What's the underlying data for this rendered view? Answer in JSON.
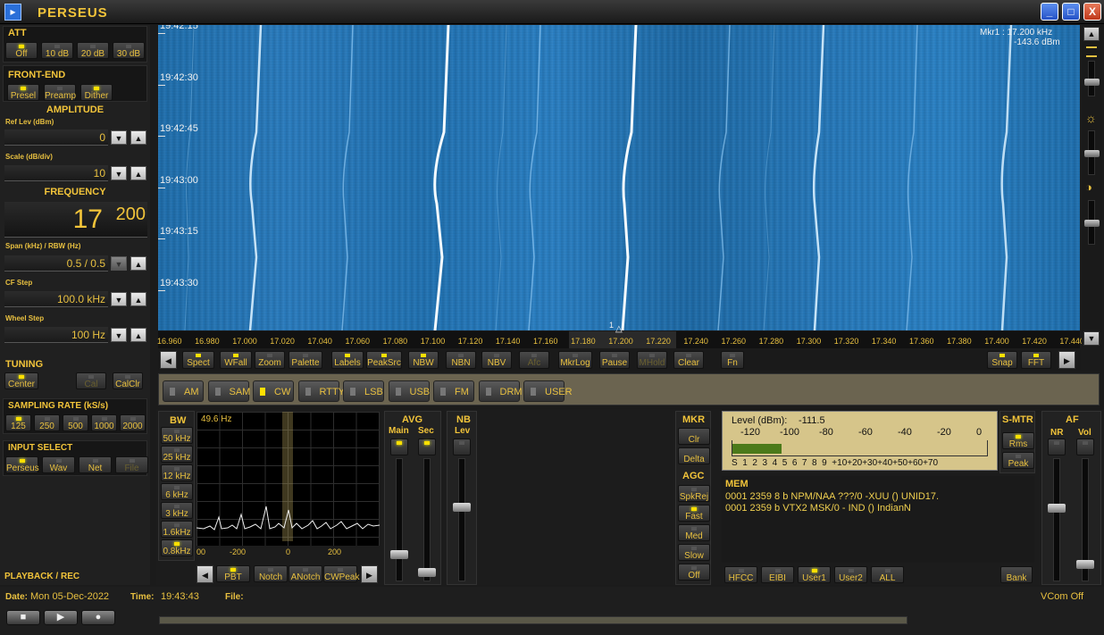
{
  "app": {
    "title": "PERSEUS",
    "logo_icon": "perseus-logo-icon"
  },
  "window_controls": {
    "minimize": "_",
    "maximize": "□",
    "close": "X"
  },
  "att": {
    "title": "ATT",
    "buttons": [
      {
        "label": "Off",
        "on": true
      },
      {
        "label": "10 dB",
        "on": false
      },
      {
        "label": "20 dB",
        "on": false
      },
      {
        "label": "30 dB",
        "on": false
      }
    ]
  },
  "frontend": {
    "title": "FRONT-END",
    "buttons": [
      {
        "label": "Presel",
        "on": true
      },
      {
        "label": "Preamp",
        "on": false
      },
      {
        "label": "Dither",
        "on": true
      }
    ]
  },
  "amplitude": {
    "title": "AMPLITUDE",
    "ref_lev_label": "Ref Lev (dBm)",
    "ref_lev_value": "0",
    "scale_label": "Scale (dB/div)",
    "scale_value": "10"
  },
  "frequency": {
    "title": "FREQUENCY",
    "main": "17",
    "sub": "200",
    "span_label": "Span (kHz) / RBW (Hz)",
    "span_value": "0.5 / 0.5",
    "cf_step_label": "CF Step",
    "cf_step_value": "100.0 kHz",
    "wheel_step_label": "Wheel Step",
    "wheel_step_value": "100 Hz"
  },
  "tuning": {
    "title": "TUNING",
    "buttons": [
      {
        "label": "Center",
        "on": true,
        "dis": false
      },
      {
        "label": "Cal",
        "on": false,
        "dis": true
      },
      {
        "label": "CalClr",
        "on": false,
        "dis": false
      }
    ]
  },
  "sampling": {
    "title": "SAMPLING RATE (kS/s)",
    "buttons": [
      {
        "label": "125",
        "on": true
      },
      {
        "label": "250",
        "on": false
      },
      {
        "label": "500",
        "on": false
      },
      {
        "label": "1000",
        "on": false
      },
      {
        "label": "2000",
        "on": false
      }
    ]
  },
  "input": {
    "title": "INPUT SELECT",
    "buttons": [
      {
        "label": "Perseus",
        "on": true,
        "dis": false
      },
      {
        "label": "Wav",
        "on": false,
        "dis": false
      },
      {
        "label": "Net",
        "on": false,
        "dis": false
      },
      {
        "label": "File",
        "on": false,
        "dis": true
      }
    ]
  },
  "playback": {
    "title": "PLAYBACK / REC"
  },
  "waterfall": {
    "times": [
      "19:42:15",
      "19:42:30",
      "19:42:45",
      "19:43:00",
      "19:43:15",
      "19:43:30"
    ],
    "marker_lines": [
      "Mkr1 : 17.200  kHz",
      "-143.6   dBm"
    ],
    "marker_num": "1",
    "axis_ticks": [
      "16.960",
      "16.980",
      "17.000",
      "17.020",
      "17.040",
      "17.060",
      "17.080",
      "17.100",
      "17.120",
      "17.140",
      "17.160",
      "17.180",
      "17.200",
      "17.220",
      "17.240",
      "17.260",
      "17.280",
      "17.300",
      "17.320",
      "17.340",
      "17.360",
      "17.380",
      "17.400",
      "17.420",
      "17.440"
    ]
  },
  "toolbar": {
    "buttons": [
      {
        "label": "Spect",
        "on": true,
        "dis": false
      },
      {
        "label": "WFall",
        "on": true,
        "dis": false
      },
      {
        "label": "Zoom",
        "on": false,
        "dis": false
      },
      {
        "label": "Palette",
        "on": false,
        "dis": false
      },
      {
        "label": "Labels",
        "on": true,
        "dis": false
      },
      {
        "label": "PeakSrc",
        "on": true,
        "dis": false
      },
      {
        "label": "NBW",
        "on": true,
        "dis": false
      },
      {
        "label": "NBN",
        "on": false,
        "dis": false
      },
      {
        "label": "NBV",
        "on": false,
        "dis": false
      },
      {
        "label": "Afc",
        "on": false,
        "dis": true
      },
      {
        "label": "MkrLog",
        "on": false,
        "dis": false
      },
      {
        "label": "Pause",
        "on": false,
        "dis": false
      },
      {
        "label": "MHold",
        "on": false,
        "dis": true
      },
      {
        "label": "Clear",
        "on": false,
        "dis": false
      },
      {
        "label": "Fn",
        "on": false,
        "dis": false
      },
      {
        "label": "Snap",
        "on": true,
        "dis": false
      },
      {
        "label": "FFT",
        "on": true,
        "dis": false
      }
    ]
  },
  "modes": [
    {
      "label": "AM",
      "on": false
    },
    {
      "label": "SAM",
      "on": false
    },
    {
      "label": "CW",
      "on": true
    },
    {
      "label": "RTTY",
      "on": false
    },
    {
      "label": "LSB",
      "on": false
    },
    {
      "label": "USB",
      "on": false
    },
    {
      "label": "FM",
      "on": false
    },
    {
      "label": "DRM",
      "on": false
    },
    {
      "label": "USER",
      "on": false
    }
  ],
  "bw": {
    "title": "BW",
    "buttons": [
      {
        "label": "50 kHz",
        "on": false
      },
      {
        "label": "25 kHz",
        "on": false
      },
      {
        "label": "12 kHz",
        "on": false
      },
      {
        "label": "6 kHz",
        "on": false
      },
      {
        "label": "3 kHz",
        "on": false
      },
      {
        "label": "1.6kHz",
        "on": false
      },
      {
        "label": "0.8kHz",
        "on": true
      }
    ],
    "plot_value": "49.6 Hz",
    "ticks": [
      "-200",
      "0",
      "200"
    ],
    "edge_tick": "00"
  },
  "bw_bottom": [
    {
      "label": "PBT",
      "on": true
    },
    {
      "label": "Notch",
      "on": false
    },
    {
      "label": "ANotch",
      "on": false
    },
    {
      "label": "CWPeak",
      "on": false
    }
  ],
  "avg": {
    "title": "AVG",
    "main": "Main",
    "sec": "Sec"
  },
  "nb": {
    "title": "NB",
    "lev": "Lev"
  },
  "mkr": {
    "title": "MKR",
    "buttons": [
      "Clr",
      "Delta"
    ]
  },
  "agc": {
    "title": "AGC",
    "buttons": [
      {
        "label": "SpkRej",
        "on": false
      },
      {
        "label": "Fast",
        "on": true
      },
      {
        "label": "Med",
        "on": false
      },
      {
        "label": "Slow",
        "on": false
      },
      {
        "label": "Off",
        "on": false
      }
    ]
  },
  "smeter": {
    "level_label": "Level (dBm):",
    "level_value": "-111.5",
    "level_fraction": 0.19,
    "dbm_scale": [
      "-120",
      "-100",
      "-80",
      "-60",
      "-40",
      "-20",
      "0"
    ],
    "s_scale": "S  1  2  3  4  5  6  7  8  9  +10+20+30+40+50+60+70"
  },
  "smtr": {
    "title": "S-MTR",
    "buttons": [
      {
        "label": "Rms",
        "on": true
      },
      {
        "label": "Peak",
        "on": false
      }
    ]
  },
  "af": {
    "title": "AF",
    "nr": "NR",
    "vol": "Vol"
  },
  "mem": {
    "title": "MEM",
    "rows": [
      "0001 2359 8 b NPM/NAA ???/0  -XUU ()   UNID17.",
      "0001 2359 b VTX2 MSK/0  - IND ()   IndianN"
    ],
    "buttons": [
      {
        "label": "HFCC",
        "on": false
      },
      {
        "label": "EIBI",
        "on": false
      },
      {
        "label": "User1",
        "on": true
      },
      {
        "label": "User2",
        "on": false
      },
      {
        "label": "ALL",
        "on": false
      }
    ],
    "bank": "Bank"
  },
  "status": {
    "date_label": "Date:",
    "date_value": "Mon 05-Dec-2022",
    "time_label": "Time:",
    "time_value": "19:43:43",
    "file_label": "File:",
    "vcom": "VCom Off"
  },
  "playback_buttons": [
    "■",
    "▶",
    "●"
  ]
}
